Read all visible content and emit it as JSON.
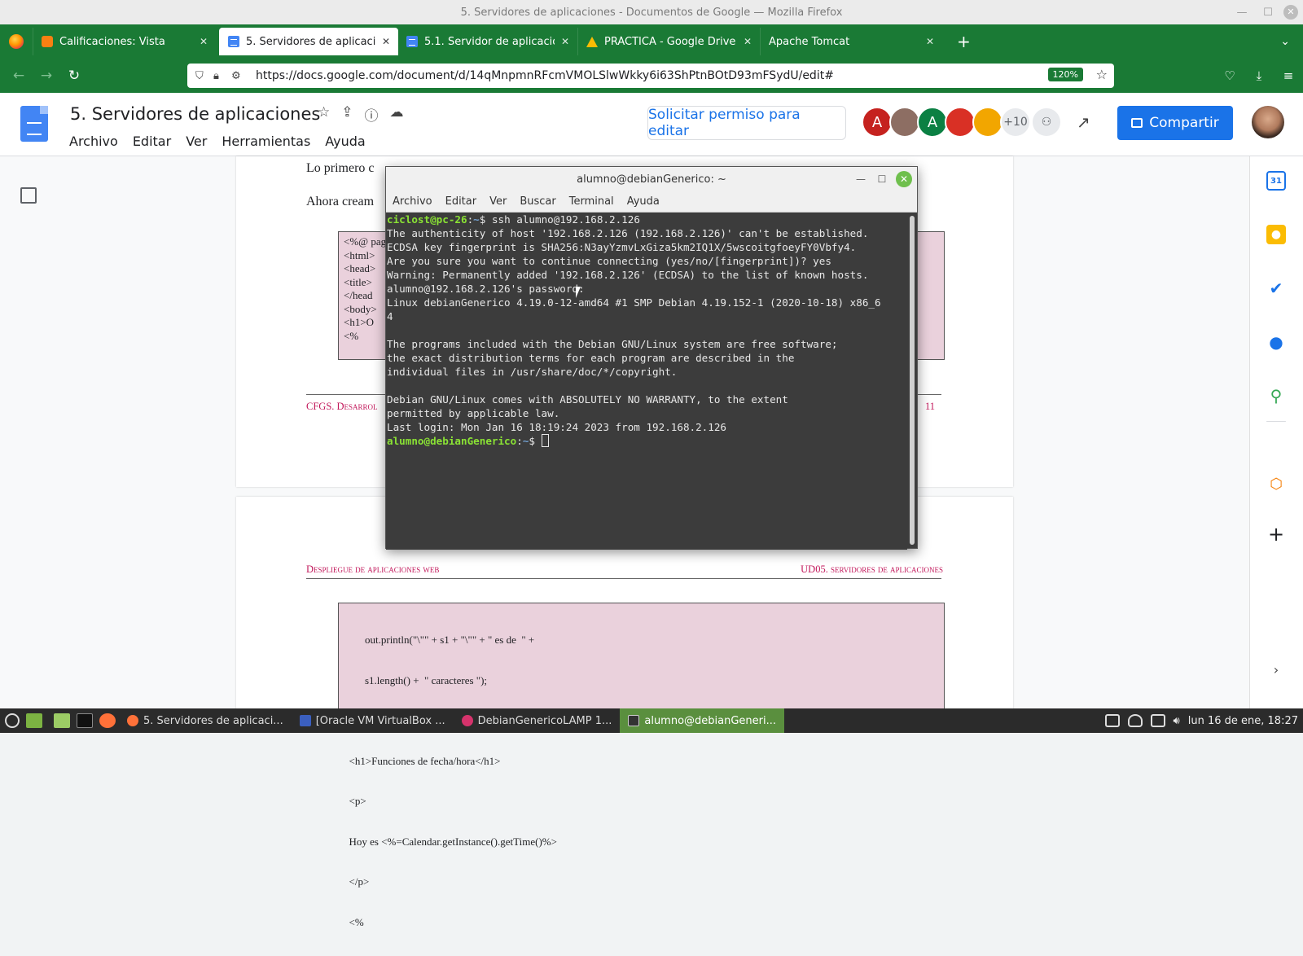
{
  "window": {
    "title": "5. Servidores de aplicaciones - Documentos de Google — Mozilla Firefox"
  },
  "tabs": [
    {
      "label": "Calificaciones: Vista",
      "icon": "moodle-icon",
      "color": "#f98012"
    },
    {
      "label": "5. Servidores de aplicaciones",
      "icon": "docs-icon",
      "color": "#4285f4"
    },
    {
      "label": "5.1. Servidor de aplicaciones",
      "icon": "docs-icon",
      "color": "#4285f4"
    },
    {
      "label": "PRÁCTICA - Google Drive",
      "icon": "drive-icon",
      "color": "#0f9d58"
    },
    {
      "label": "Apache Tomcat",
      "icon": "",
      "color": ""
    }
  ],
  "address": {
    "url": "https://docs.google.com/document/d/14qMnpmnRFcmVMOLSlwWkky6i63ShPtnBOtD93mFSydU/edit#",
    "zoom": "120%"
  },
  "doc": {
    "title": "5. Servidores de aplicaciones",
    "menu": [
      "Archivo",
      "Editar",
      "Ver",
      "Herramientas",
      "Ayuda"
    ],
    "request_edit": "Solicitar permiso para editar",
    "share": "Compartir",
    "collaborators": [
      {
        "initial": "A",
        "color": "#c5221f"
      },
      {
        "initial": "",
        "color": "#8d6e63"
      },
      {
        "initial": "A",
        "color": "#0b8043"
      },
      {
        "initial": "",
        "color": "#d93025"
      },
      {
        "initial": "",
        "color": "#f2a600"
      }
    ],
    "more_collaborators": "+10",
    "page1": {
      "line1": "Lo primero c",
      "line2": "Ahora cream",
      "code": [
        "<%@ pag",
        "<html>",
        " <head>",
        "  <title>",
        " </head",
        " <body>",
        "  <h1>O",
        "  <%"
      ],
      "footer_left": "CFGS. Desarrol",
      "footer_right": "11"
    },
    "page2": {
      "header_left": "Despliegue de aplicaciones web",
      "header_right": "UD05. servidores de aplicaciones",
      "code": [
        "        out.println(\"\\\"\" + s1 + \"\\\"\" + \" es de  \" +",
        "        s1.length() +  \" caracteres \");",
        "  %>",
        "  <h1>Funciones de fecha/hora</h1>",
        "  <p>",
        "  Hoy es <%=Calendar.getInstance().getTime()%>",
        "  </p>",
        "  <%"
      ]
    }
  },
  "terminal": {
    "title": "alumno@debianGenerico: ~",
    "menu": [
      "Archivo",
      "Editar",
      "Ver",
      "Buscar",
      "Terminal",
      "Ayuda"
    ],
    "prompt1_user": "ciclost@pc-26",
    "prompt1_path": "~",
    "command1": "ssh alumno@192.168.2.126",
    "output": [
      "The authenticity of host '192.168.2.126 (192.168.2.126)' can't be established.",
      "ECDSA key fingerprint is SHA256:N3ayYzmvLxGiza5km2IQ1X/5wscoitgfoeyFY0Vbfy4.",
      "Are you sure you want to continue connecting (yes/no/[fingerprint])? yes",
      "Warning: Permanently added '192.168.2.126' (ECDSA) to the list of known hosts.",
      "alumno@192.168.2.126's password: ",
      "Linux debianGenerico 4.19.0-12-amd64 #1 SMP Debian 4.19.152-1 (2020-10-18) x86_6",
      "4",
      "",
      "The programs included with the Debian GNU/Linux system are free software;",
      "the exact distribution terms for each program are described in the",
      "individual files in /usr/share/doc/*/copyright.",
      "",
      "Debian GNU/Linux comes with ABSOLUTELY NO WARRANTY, to the extent",
      "permitted by applicable law.",
      "Last login: Mon Jan 16 18:19:24 2023 from 192.168.2.126"
    ],
    "prompt2_user": "alumno@debianGenerico",
    "prompt2_path": "~"
  },
  "taskbar": {
    "items": [
      {
        "label": "5. Servidores de aplicaci...",
        "color": "#ff7139"
      },
      {
        "label": "[Oracle VM VirtualBox ...",
        "color": "#3b5fbf"
      },
      {
        "label": "DebianGenericoLAMP 1...",
        "color": "#d6336c"
      },
      {
        "label": "alumno@debianGeneri...",
        "color": "#333333"
      }
    ],
    "clock": "lun 16 de ene, 18:27"
  }
}
